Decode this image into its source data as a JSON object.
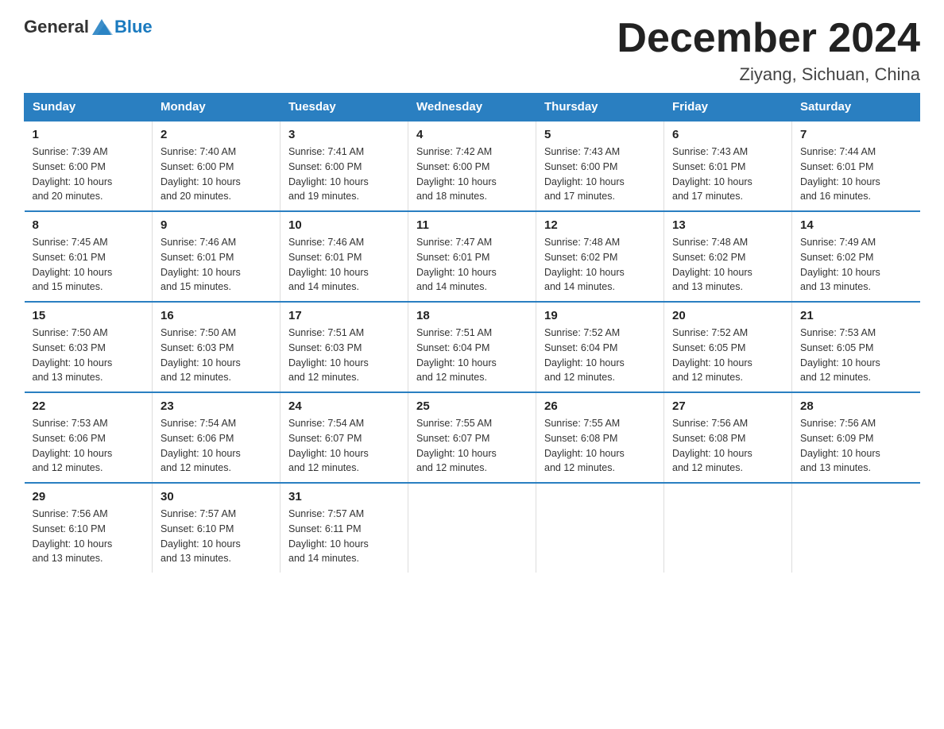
{
  "logo": {
    "general": "General",
    "blue": "Blue"
  },
  "title": "December 2024",
  "location": "Ziyang, Sichuan, China",
  "headers": [
    "Sunday",
    "Monday",
    "Tuesday",
    "Wednesday",
    "Thursday",
    "Friday",
    "Saturday"
  ],
  "weeks": [
    [
      {
        "day": "1",
        "sunrise": "7:39 AM",
        "sunset": "6:00 PM",
        "daylight": "10 hours and 20 minutes."
      },
      {
        "day": "2",
        "sunrise": "7:40 AM",
        "sunset": "6:00 PM",
        "daylight": "10 hours and 20 minutes."
      },
      {
        "day": "3",
        "sunrise": "7:41 AM",
        "sunset": "6:00 PM",
        "daylight": "10 hours and 19 minutes."
      },
      {
        "day": "4",
        "sunrise": "7:42 AM",
        "sunset": "6:00 PM",
        "daylight": "10 hours and 18 minutes."
      },
      {
        "day": "5",
        "sunrise": "7:43 AM",
        "sunset": "6:00 PM",
        "daylight": "10 hours and 17 minutes."
      },
      {
        "day": "6",
        "sunrise": "7:43 AM",
        "sunset": "6:01 PM",
        "daylight": "10 hours and 17 minutes."
      },
      {
        "day": "7",
        "sunrise": "7:44 AM",
        "sunset": "6:01 PM",
        "daylight": "10 hours and 16 minutes."
      }
    ],
    [
      {
        "day": "8",
        "sunrise": "7:45 AM",
        "sunset": "6:01 PM",
        "daylight": "10 hours and 15 minutes."
      },
      {
        "day": "9",
        "sunrise": "7:46 AM",
        "sunset": "6:01 PM",
        "daylight": "10 hours and 15 minutes."
      },
      {
        "day": "10",
        "sunrise": "7:46 AM",
        "sunset": "6:01 PM",
        "daylight": "10 hours and 14 minutes."
      },
      {
        "day": "11",
        "sunrise": "7:47 AM",
        "sunset": "6:01 PM",
        "daylight": "10 hours and 14 minutes."
      },
      {
        "day": "12",
        "sunrise": "7:48 AM",
        "sunset": "6:02 PM",
        "daylight": "10 hours and 14 minutes."
      },
      {
        "day": "13",
        "sunrise": "7:48 AM",
        "sunset": "6:02 PM",
        "daylight": "10 hours and 13 minutes."
      },
      {
        "day": "14",
        "sunrise": "7:49 AM",
        "sunset": "6:02 PM",
        "daylight": "10 hours and 13 minutes."
      }
    ],
    [
      {
        "day": "15",
        "sunrise": "7:50 AM",
        "sunset": "6:03 PM",
        "daylight": "10 hours and 13 minutes."
      },
      {
        "day": "16",
        "sunrise": "7:50 AM",
        "sunset": "6:03 PM",
        "daylight": "10 hours and 12 minutes."
      },
      {
        "day": "17",
        "sunrise": "7:51 AM",
        "sunset": "6:03 PM",
        "daylight": "10 hours and 12 minutes."
      },
      {
        "day": "18",
        "sunrise": "7:51 AM",
        "sunset": "6:04 PM",
        "daylight": "10 hours and 12 minutes."
      },
      {
        "day": "19",
        "sunrise": "7:52 AM",
        "sunset": "6:04 PM",
        "daylight": "10 hours and 12 minutes."
      },
      {
        "day": "20",
        "sunrise": "7:52 AM",
        "sunset": "6:05 PM",
        "daylight": "10 hours and 12 minutes."
      },
      {
        "day": "21",
        "sunrise": "7:53 AM",
        "sunset": "6:05 PM",
        "daylight": "10 hours and 12 minutes."
      }
    ],
    [
      {
        "day": "22",
        "sunrise": "7:53 AM",
        "sunset": "6:06 PM",
        "daylight": "10 hours and 12 minutes."
      },
      {
        "day": "23",
        "sunrise": "7:54 AM",
        "sunset": "6:06 PM",
        "daylight": "10 hours and 12 minutes."
      },
      {
        "day": "24",
        "sunrise": "7:54 AM",
        "sunset": "6:07 PM",
        "daylight": "10 hours and 12 minutes."
      },
      {
        "day": "25",
        "sunrise": "7:55 AM",
        "sunset": "6:07 PM",
        "daylight": "10 hours and 12 minutes."
      },
      {
        "day": "26",
        "sunrise": "7:55 AM",
        "sunset": "6:08 PM",
        "daylight": "10 hours and 12 minutes."
      },
      {
        "day": "27",
        "sunrise": "7:56 AM",
        "sunset": "6:08 PM",
        "daylight": "10 hours and 12 minutes."
      },
      {
        "day": "28",
        "sunrise": "7:56 AM",
        "sunset": "6:09 PM",
        "daylight": "10 hours and 13 minutes."
      }
    ],
    [
      {
        "day": "29",
        "sunrise": "7:56 AM",
        "sunset": "6:10 PM",
        "daylight": "10 hours and 13 minutes."
      },
      {
        "day": "30",
        "sunrise": "7:57 AM",
        "sunset": "6:10 PM",
        "daylight": "10 hours and 13 minutes."
      },
      {
        "day": "31",
        "sunrise": "7:57 AM",
        "sunset": "6:11 PM",
        "daylight": "10 hours and 14 minutes."
      },
      null,
      null,
      null,
      null
    ]
  ],
  "labels": {
    "sunrise": "Sunrise:",
    "sunset": "Sunset:",
    "daylight": "Daylight:"
  }
}
